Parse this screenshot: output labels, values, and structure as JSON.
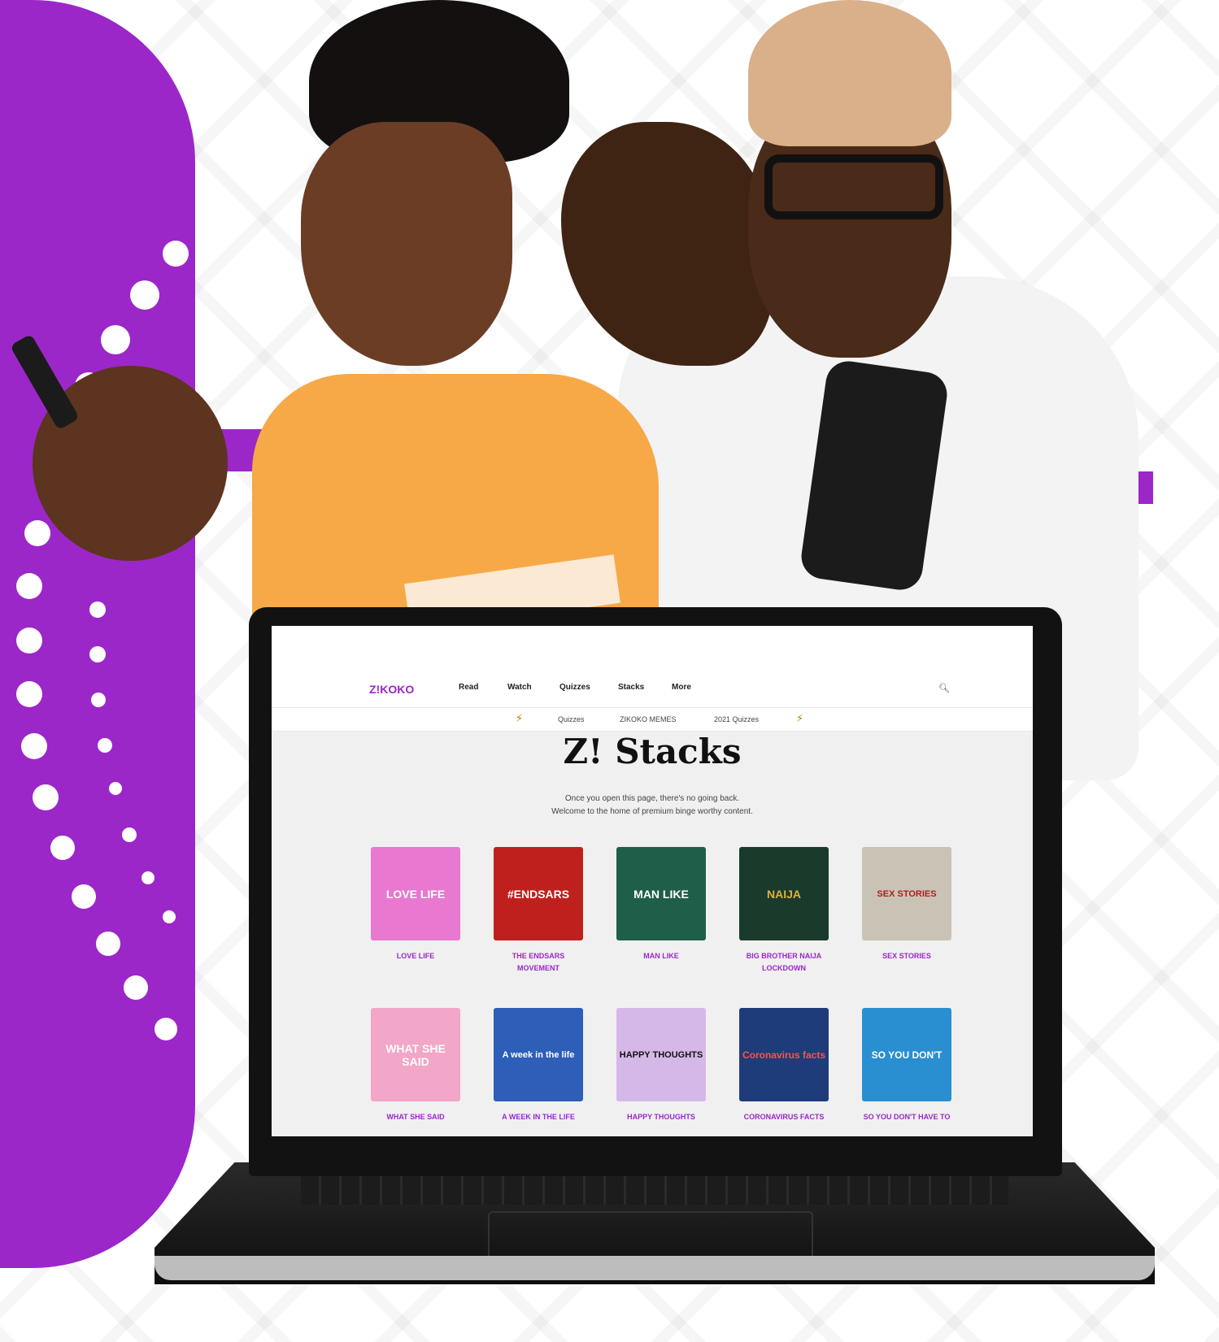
{
  "site": {
    "logo": "Z!KOKO",
    "nav": [
      "Read",
      "Watch",
      "Quizzes",
      "Stacks",
      "More"
    ],
    "subnav": [
      "Quizzes",
      "ZIKOKO MEMES",
      "2021 Quizzes"
    ]
  },
  "page": {
    "title": "Z! Stacks",
    "subtitle_line1": "Once you open this page, there's no going back.",
    "subtitle_line2": "Welcome to the home of premium binge worthy content."
  },
  "stacks": [
    {
      "label": "LOVE LIFE",
      "thumb_text": "LOVE LIFE",
      "color": "#e878d0"
    },
    {
      "label": "THE ENDSARS MOVEMENT",
      "thumb_text": "#ENDSARS",
      "color": "#c0201d"
    },
    {
      "label": "MAN LIKE",
      "thumb_text": "MAN LIKE",
      "color": "#1f5f4a"
    },
    {
      "label": "BIG BROTHER NAIJA LOCKDOWN",
      "thumb_text": "NAIJA",
      "color": "#1a3b2b"
    },
    {
      "label": "SEX STORIES",
      "thumb_text": "SEX STORIES",
      "color": "#3a8fb0"
    },
    {
      "label": "WHAT SHE SAID",
      "thumb_text": "WHAT SHE SAID",
      "color": "#f2a6c8"
    },
    {
      "label": "A WEEK IN THE LIFE",
      "thumb_text": "A week in the life",
      "color": "#2d5fb8"
    },
    {
      "label": "HAPPY THOUGHTS",
      "thumb_text": "HAPPY THOUGHTS",
      "color": "#d6b8e8"
    },
    {
      "label": "CORONAVIRUS FACTS",
      "thumb_text": "Coronavirus facts",
      "color": "#1f3c7a"
    },
    {
      "label": "SO YOU DON'T HAVE TO",
      "thumb_text": "SO YOU DON'T",
      "color": "#2a8fd0"
    }
  ],
  "colors": {
    "accent": "#9b27c9"
  }
}
